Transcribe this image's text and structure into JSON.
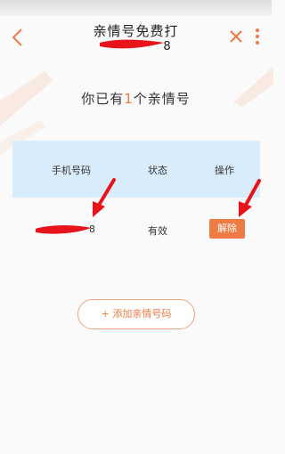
{
  "header": {
    "title": "亲情号免费打",
    "subtitle_visible_tail": "8"
  },
  "icons": {
    "back": "chevron-left-icon",
    "close": "close-icon",
    "more": "more-vertical-icon"
  },
  "summary": {
    "prefix": "你已有",
    "count": "1",
    "suffix": "个亲情号"
  },
  "table": {
    "headers": [
      "手机号码",
      "状态",
      "操作"
    ],
    "rows": [
      {
        "phone_visible_tail": "8",
        "status": "有效",
        "action": "解除"
      }
    ]
  },
  "add_button": {
    "label": "+ 添加亲情号码"
  },
  "colors": {
    "accent": "#ef7b44",
    "table_header_bg": "#d9ecfb",
    "annotation_red": "#e8141b"
  }
}
